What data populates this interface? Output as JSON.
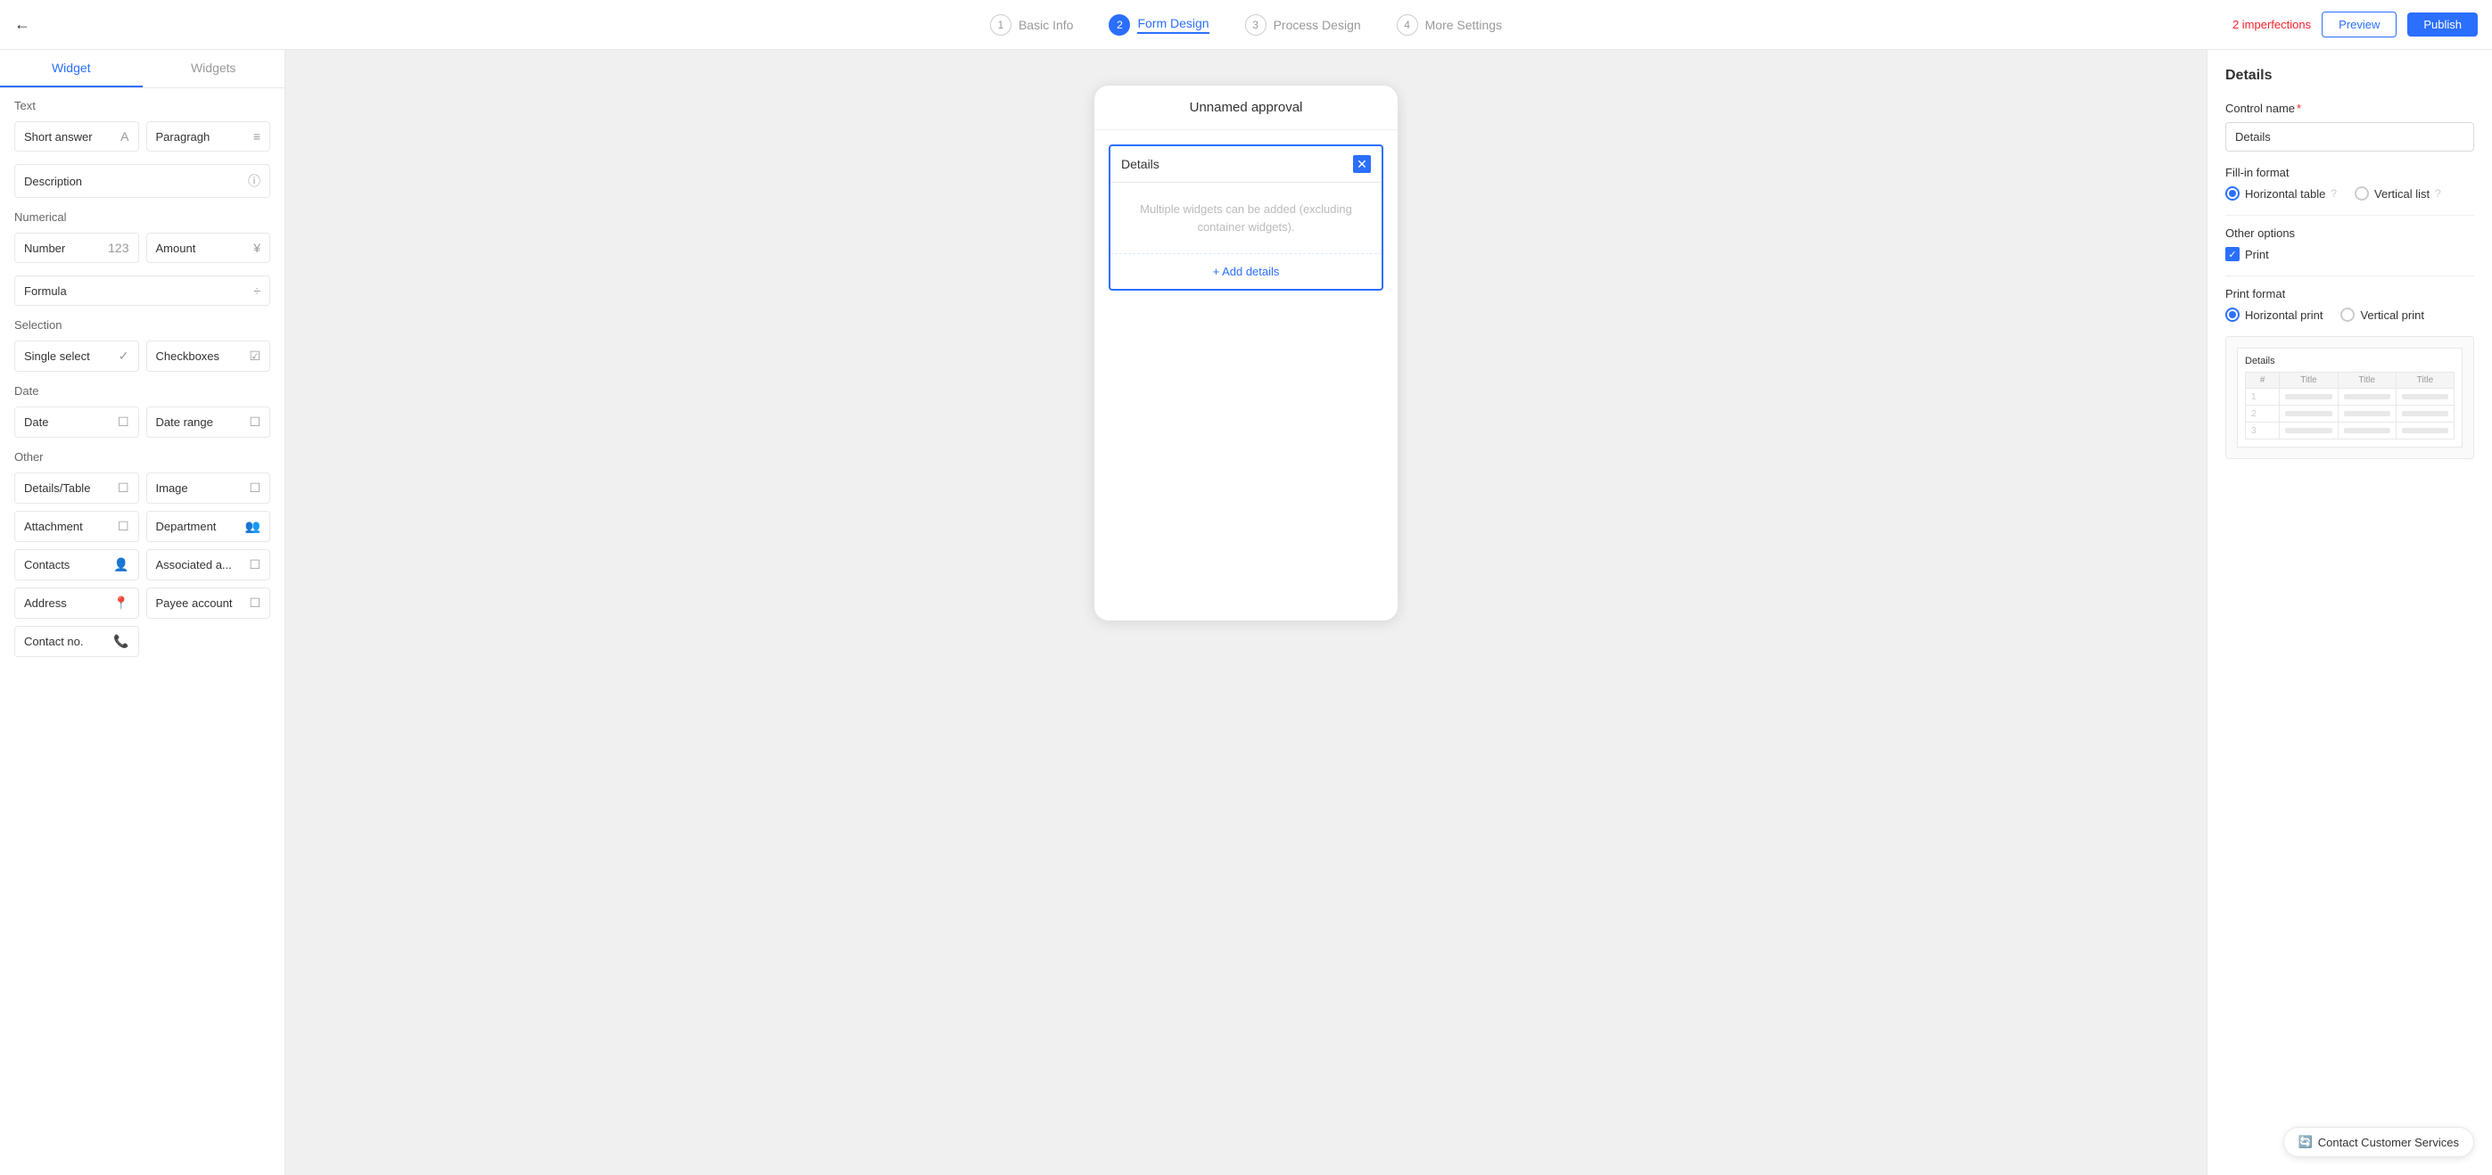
{
  "nav": {
    "back_icon": "←",
    "steps": [
      {
        "num": "1",
        "label": "Basic Info",
        "active": false
      },
      {
        "num": "2",
        "label": "Form Design",
        "active": true
      },
      {
        "num": "3",
        "label": "Process Design",
        "active": false
      },
      {
        "num": "4",
        "label": "More Settings",
        "active": false
      }
    ],
    "imperfections": "2 imperfections",
    "preview_label": "Preview",
    "publish_label": "Publish"
  },
  "left": {
    "tab1": "Widget",
    "tab2": "Widgets",
    "text_section": "Text",
    "numerical_section": "Numerical",
    "selection_section": "Selection",
    "date_section": "Date",
    "other_section": "Other",
    "widgets": {
      "text": [
        {
          "label": "Short answer",
          "icon": "A"
        },
        {
          "label": "Paragragh",
          "icon": "≡"
        },
        {
          "label": "Description",
          "icon": "ⓘ"
        }
      ],
      "numerical": [
        {
          "label": "Number",
          "icon": "123"
        },
        {
          "label": "Amount",
          "icon": "¥"
        },
        {
          "label": "Formula",
          "icon": "÷"
        }
      ],
      "selection": [
        {
          "label": "Single select",
          "icon": "✓"
        },
        {
          "label": "Checkboxes",
          "icon": "☑"
        }
      ],
      "date": [
        {
          "label": "Date",
          "icon": "☐"
        },
        {
          "label": "Date range",
          "icon": "☐"
        }
      ],
      "other": [
        {
          "label": "Details/Table",
          "icon": "☐"
        },
        {
          "label": "Image",
          "icon": "☐"
        },
        {
          "label": "Attachment",
          "icon": "☐"
        },
        {
          "label": "Department",
          "icon": "👥"
        },
        {
          "label": "Contacts",
          "icon": "👤"
        },
        {
          "label": "Associated a...",
          "icon": "☐"
        },
        {
          "label": "Address",
          "icon": "📍"
        },
        {
          "label": "Payee account",
          "icon": "☐"
        },
        {
          "label": "Contact no.",
          "icon": "📞"
        }
      ]
    }
  },
  "center": {
    "form_title": "Unnamed approval",
    "details_label": "Details",
    "details_hint": "Multiple widgets can be added (excluding container widgets).",
    "add_label": "+ Add details"
  },
  "right": {
    "panel_title": "Details",
    "control_name_label": "Control name",
    "required_mark": "*",
    "control_name_value": "Details",
    "fill_format_label": "Fill-in format",
    "horizontal_table": "Horizontal table",
    "vertical_list": "Vertical list",
    "other_options_label": "Other options",
    "print_label": "Print",
    "print_format_label": "Print format",
    "horizontal_print": "Horizontal print",
    "vertical_print": "Vertical print",
    "preview_table_title": "Details",
    "preview_headers": [
      "#",
      "Title",
      "Title",
      "Title"
    ],
    "preview_rows": [
      "1",
      "2",
      "3"
    ]
  },
  "contact": {
    "icon": "🔄",
    "label": "Contact Customer Services"
  }
}
